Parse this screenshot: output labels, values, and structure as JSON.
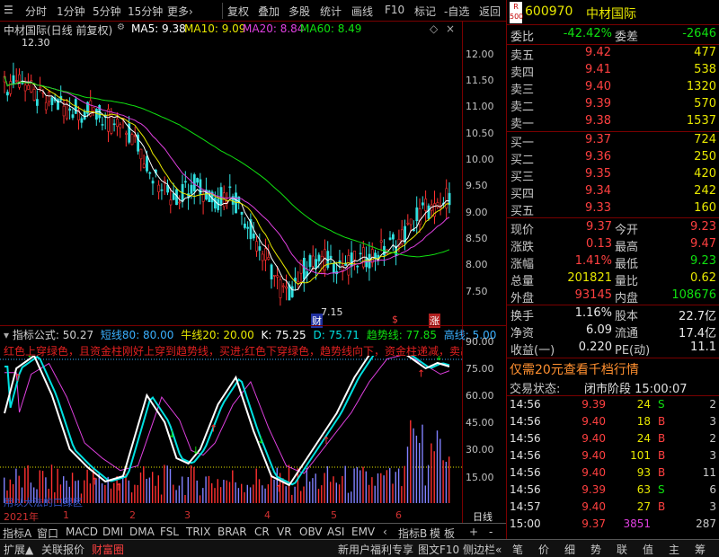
{
  "toolbar": {
    "items": [
      "分时",
      "1分钟",
      "5分钟",
      "15分钟",
      "更多›",
      "复权",
      "叠加",
      "多股",
      "统计",
      "画线",
      "F10",
      "标记",
      "-自选",
      "返回"
    ]
  },
  "chart": {
    "title": "中材国际(日线 前复权)",
    "ma5": "MA5: 9.38",
    "ma10": "MA10: 9.09",
    "ma20": "MA20: 8.84",
    "ma60": "MA60: 8.49",
    "high_label": "12.30",
    "low_label": "7.15",
    "marker_cai": "财",
    "marker_s": "$",
    "marker_zhang": "涨",
    "y_ticks": [
      "12.00",
      "11.50",
      "11.00",
      "10.50",
      "10.00",
      "9.50",
      "9.00",
      "8.50",
      "8.00",
      "7.50"
    ],
    "colors": {
      "ma5": "#ffffff",
      "ma10": "#e8e800",
      "ma20": "#e040e0",
      "ma60": "#10e010"
    }
  },
  "indicator": {
    "name": "指标公式",
    "v1": ": 50.27",
    "short_line": "短线80: 80.00",
    "bull_line": "牛线20: 20.00",
    "k": "K: 75.25",
    "d": "D: 75.71",
    "trend": "趋势线: 77.85",
    "high_line": "高线: 5.00",
    "formula_text": "红色上穿绿色，且资金柱刚好上穿到趋势线，买进;红色下穿绿色，趋势线向下，资金柱递减，卖出",
    "y_ticks": [
      "90.00",
      "75.00",
      "60.00",
      "45.00",
      "30.00",
      "15.00"
    ],
    "watermark": "用以大法的口绿区"
  },
  "date_axis": {
    "year": "2021年",
    "months": [
      "1",
      "2",
      "3",
      "4",
      "5",
      "6"
    ],
    "period": "日线"
  },
  "tabs": [
    "指标A",
    "窗口",
    "MACD",
    "DMI",
    "DMA",
    "FSL",
    "TRIX",
    "BRAR",
    "CR",
    "VR",
    "OBV",
    "ASI",
    "EMV",
    "‹",
    "指标B",
    "模",
    "板",
    "+",
    "-"
  ],
  "bottom_tabs": [
    "扩展▲",
    "关联报价",
    "财富圈",
    "新用户福利专享",
    "图文F10",
    "侧边栏«",
    "笔",
    "价",
    "细",
    "势",
    "联",
    "值",
    "主",
    "筹"
  ],
  "stock": {
    "badge": "R 500",
    "code": "600970",
    "name": "中材国际"
  },
  "quote": {
    "wei_bi_label": "委比",
    "wei_bi": "-42.42%",
    "wei_cha_label": "委差",
    "wei_cha": "-2646",
    "asks": [
      {
        "label": "卖五",
        "price": "9.42",
        "vol": "477"
      },
      {
        "label": "卖四",
        "price": "9.41",
        "vol": "538"
      },
      {
        "label": "卖三",
        "price": "9.40",
        "vol": "1320"
      },
      {
        "label": "卖二",
        "price": "9.39",
        "vol": "570"
      },
      {
        "label": "卖一",
        "price": "9.38",
        "vol": "1537"
      }
    ],
    "bids": [
      {
        "label": "买一",
        "price": "9.37",
        "vol": "724"
      },
      {
        "label": "买二",
        "price": "9.36",
        "vol": "250"
      },
      {
        "label": "买三",
        "price": "9.35",
        "vol": "420"
      },
      {
        "label": "买四",
        "price": "9.34",
        "vol": "242"
      },
      {
        "label": "买五",
        "price": "9.33",
        "vol": "160"
      }
    ],
    "stats": [
      {
        "l1": "现价",
        "v1": "9.37",
        "l2": "今开",
        "v2": "9.23"
      },
      {
        "l1": "涨跌",
        "v1": "0.13",
        "l2": "最高",
        "v2": "9.47"
      },
      {
        "l1": "涨幅",
        "v1": "1.41%",
        "l2": "最低",
        "v2": "9.23"
      },
      {
        "l1": "总量",
        "v1": "201821",
        "l2": "量比",
        "v2": "0.62"
      },
      {
        "l1": "外盘",
        "v1": "93145",
        "l2": "内盘",
        "v2": "108676"
      }
    ],
    "stats2": [
      {
        "l1": "换手",
        "v1": "1.16%",
        "l2": "股本",
        "v2": "22.7亿"
      },
      {
        "l1": "净资",
        "v1": "6.09",
        "l2": "流通",
        "v2": "17.4亿"
      },
      {
        "l1": "收益(一)",
        "v1": "0.220",
        "l2": "PE(动)",
        "v2": "11.1"
      }
    ],
    "promo": "仅需20元查看千档行情",
    "status_label": "交易状态:",
    "status": "闭市阶段 15:00:07"
  },
  "trades": [
    {
      "t": "14:56",
      "p": "9.39",
      "q": "24",
      "d": "S",
      "n": "2"
    },
    {
      "t": "14:56",
      "p": "9.40",
      "q": "18",
      "d": "B",
      "n": "3"
    },
    {
      "t": "14:56",
      "p": "9.40",
      "q": "24",
      "d": "B",
      "n": "2"
    },
    {
      "t": "14:56",
      "p": "9.40",
      "q": "101",
      "d": "B",
      "n": "3"
    },
    {
      "t": "14:56",
      "p": "9.40",
      "q": "93",
      "d": "B",
      "n": "11"
    },
    {
      "t": "14:56",
      "p": "9.39",
      "q": "63",
      "d": "S",
      "n": "6"
    },
    {
      "t": "14:57",
      "p": "9.40",
      "q": "27",
      "d": "B",
      "n": "3"
    },
    {
      "t": "15:00",
      "p": "9.37",
      "q": "3851",
      "d": "",
      "n": "287"
    }
  ]
}
